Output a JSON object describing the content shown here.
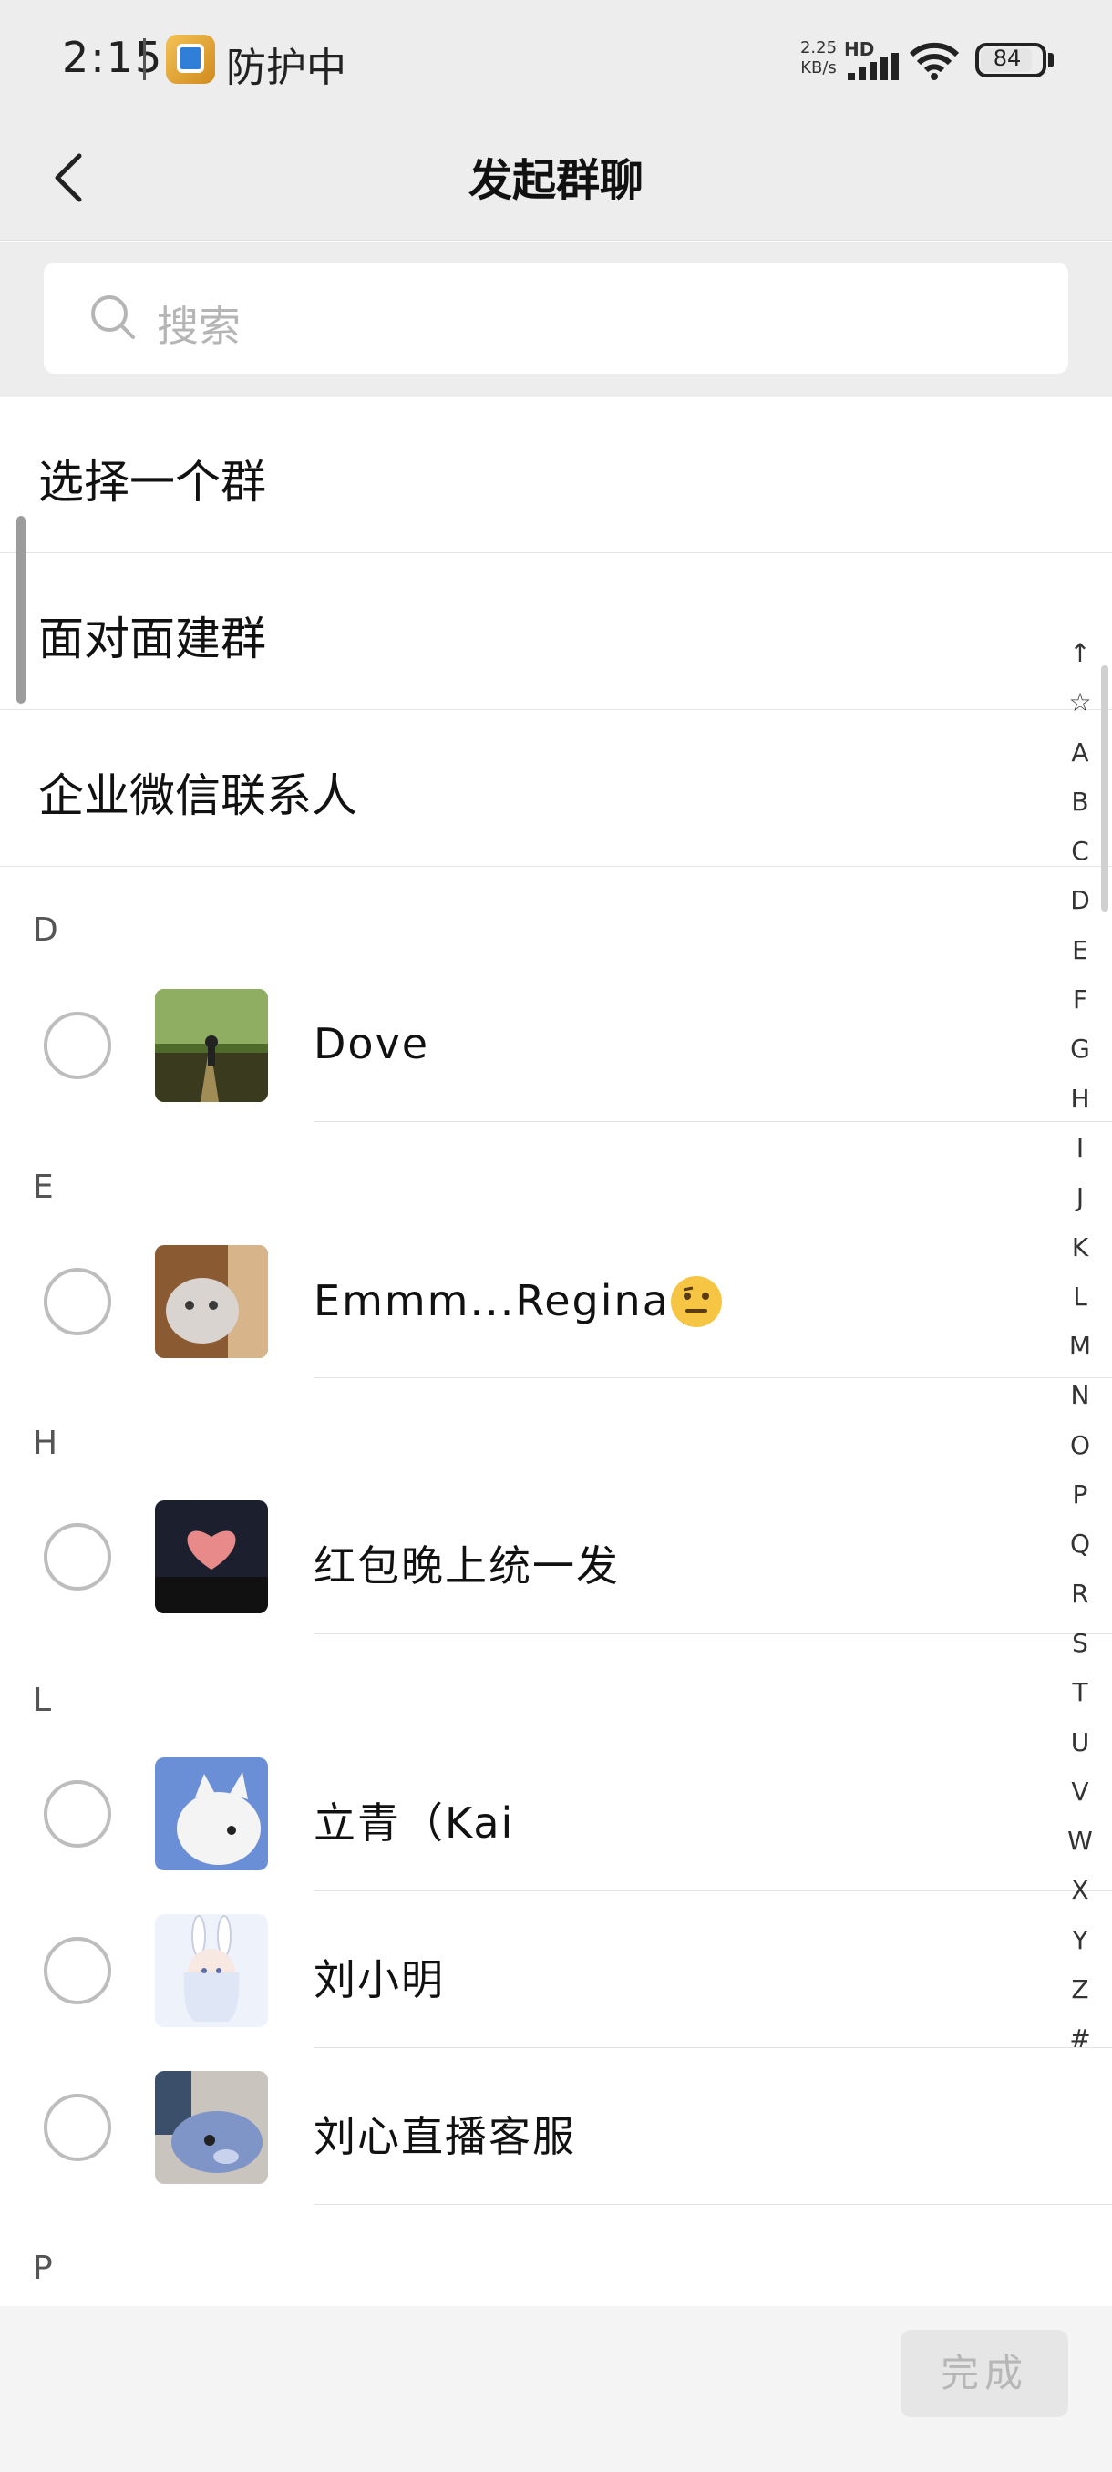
{
  "status_bar": {
    "time": "2:15",
    "app_status": "防护中",
    "net_speed_value": "2.25",
    "net_speed_unit": "KB/s",
    "hd_label": "HD",
    "battery": "84"
  },
  "nav": {
    "title": "发起群聊"
  },
  "search": {
    "placeholder": "搜索"
  },
  "menu": [
    {
      "label": "选择一个群"
    },
    {
      "label": "面对面建群"
    },
    {
      "label": "企业微信联系人"
    }
  ],
  "sections": [
    {
      "letter": "D",
      "contacts": [
        {
          "name": "Dove"
        }
      ]
    },
    {
      "letter": "E",
      "contacts": [
        {
          "name": "Emmm...Regina J"
        }
      ]
    },
    {
      "letter": "H",
      "contacts": [
        {
          "name": "红包晚上统一发"
        }
      ]
    },
    {
      "letter": "L",
      "contacts": [
        {
          "name": "立青（Kai"
        },
        {
          "name": "刘小明"
        },
        {
          "name": "刘心直播客服"
        }
      ]
    },
    {
      "letter": "P",
      "contacts": []
    }
  ],
  "alphabet_index": [
    "↑",
    "☆",
    "A",
    "B",
    "C",
    "D",
    "E",
    "F",
    "G",
    "H",
    "I",
    "J",
    "K",
    "L",
    "M",
    "N",
    "O",
    "P",
    "Q",
    "R",
    "S",
    "T",
    "U",
    "V",
    "W",
    "X",
    "Y",
    "Z",
    "#"
  ],
  "bottom": {
    "done_label": "完成"
  },
  "colors": {
    "header_bg": "#ededed",
    "accent": "#07c160",
    "done_disabled_text": "#b7b7b7"
  }
}
